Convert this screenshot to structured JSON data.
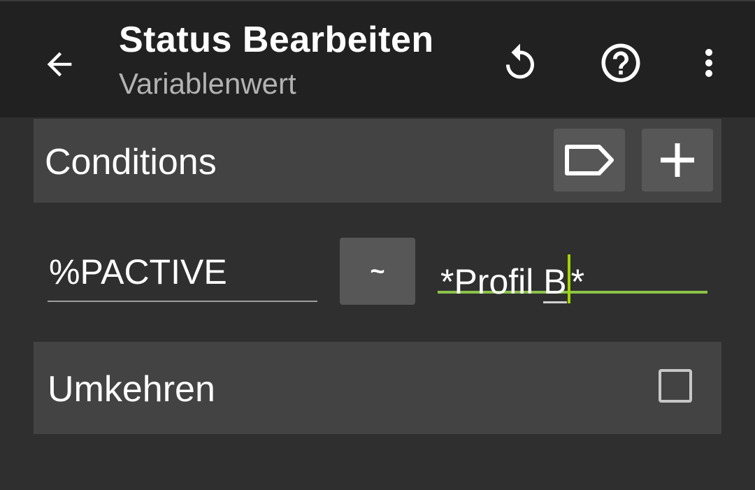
{
  "appbar": {
    "title": "Status Bearbeiten",
    "subtitle": "Variablenwert",
    "icons": [
      "back-arrow-icon",
      "reset-icon",
      "help-icon",
      "more-vert-icon"
    ]
  },
  "conditions": {
    "label": "Conditions",
    "icons": [
      "tag-icon",
      "add-icon"
    ]
  },
  "condition": {
    "variable": "%PACTIVE",
    "operator": "~",
    "value_prefix": "*Profil ",
    "value_underlined": "B",
    "value_suffix": "*"
  },
  "invert": {
    "label": "Umkehren",
    "checked": false
  },
  "colors": {
    "appbar": "#212121",
    "background": "#2f2f2f",
    "section": "#434343",
    "button": "#575757",
    "accent": "#8bc34a"
  }
}
